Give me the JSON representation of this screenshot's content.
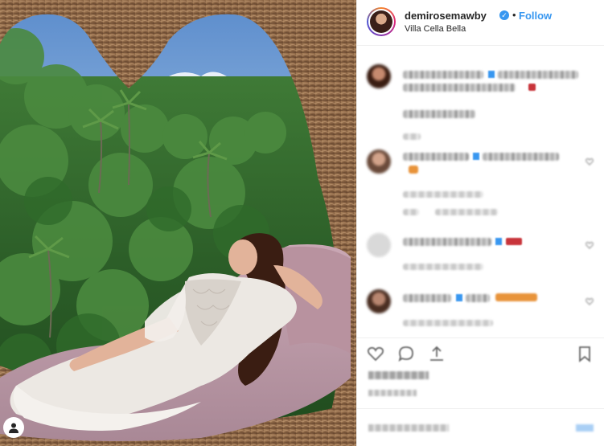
{
  "post": {
    "username": "demirosemawby",
    "verified_icon": "verified-badge-icon",
    "separator": "•",
    "follow_label": "Follow",
    "location": "Villa Cella Bella",
    "more_icon": "ellipsis-icon"
  },
  "photo": {
    "description_icon": "camera-icon"
  },
  "comments": {
    "count_visible": 5,
    "content": "blurred"
  },
  "actions": {
    "icons": [
      "heart-icon",
      "comment-icon",
      "share-icon",
      "bookmark-icon"
    ]
  },
  "colors": {
    "link_blue": "#3897f0",
    "text": "#262626",
    "border": "#efefef"
  }
}
